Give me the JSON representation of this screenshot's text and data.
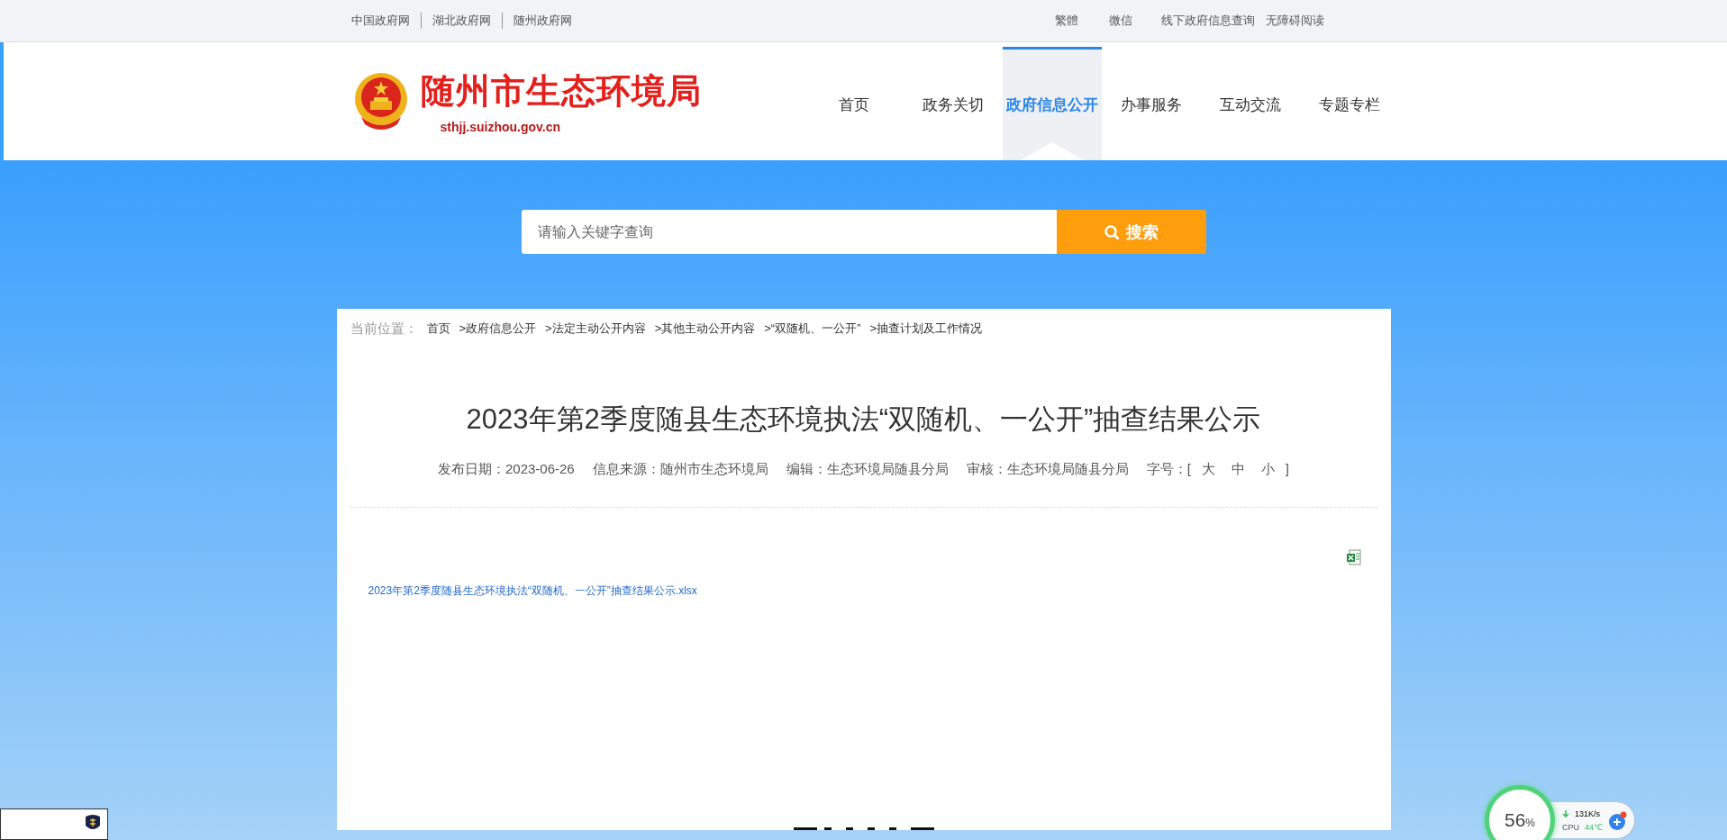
{
  "top_bar": {
    "left_links": [
      "中国政府网",
      "湖北政府网",
      "随州政府网"
    ],
    "right_links": [
      "繁體",
      "微信",
      "线下政府信息查询",
      "无障碍阅读"
    ]
  },
  "header": {
    "site_title": "随州市生态环境局",
    "site_url": "sthjj.suizhou.gov.cn",
    "nav": [
      {
        "label": "首页",
        "selected": false
      },
      {
        "label": "政务关切",
        "selected": false
      },
      {
        "label": "政府信息公开",
        "selected": true
      },
      {
        "label": "办事服务",
        "selected": false
      },
      {
        "label": "互动交流",
        "selected": false
      },
      {
        "label": "专题专栏",
        "selected": false
      }
    ]
  },
  "search": {
    "placeholder": "请输入关键字查询",
    "button": "搜索"
  },
  "breadcrumb": {
    "label": "当前位置：",
    "items": [
      "首页",
      ">政府信息公开",
      ">法定主动公开内容",
      ">其他主动公开内容",
      ">“双随机、一公开”",
      ">抽查计划及工作情况"
    ]
  },
  "article": {
    "title": "2023年第2季度随县生态环境执法“双随机、一公开”抽查结果公示",
    "meta": [
      {
        "label": "发布日期：",
        "value": "2023-06-26"
      },
      {
        "label": "信息来源：",
        "value": "随州市生态环境局"
      },
      {
        "label": "编辑：",
        "value": "生态环境局随县分局"
      },
      {
        "label": "审核：",
        "value": "生态环境局随县分局"
      }
    ],
    "font_size": {
      "label": "字号：",
      "open": "[",
      "options": [
        "大",
        "中",
        "小"
      ],
      "close": "]"
    },
    "attachment": "2023年第2季度随县生态环境执法“双随机、一公开”抽查结果公示.xlsx"
  },
  "monitor": {
    "percent": "56",
    "unit": "%",
    "speed": "131K/s",
    "cpu_label": "CPU",
    "temperature": "44℃"
  }
}
